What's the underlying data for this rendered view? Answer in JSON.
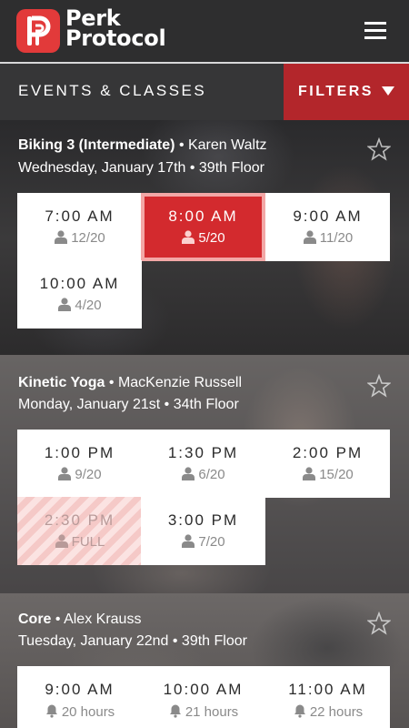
{
  "app": {
    "brand_line1": "Perk",
    "brand_line2": "Protocol"
  },
  "subbar": {
    "heading": "EVENTS & CLASSES",
    "filters_label": "FILTERS"
  },
  "colors": {
    "accent": "#d32a2e",
    "filters_bg": "#b3262b",
    "logo": "#e23a3a"
  },
  "events": [
    {
      "name": "Biking 3 (Intermediate)",
      "instructor": "• Karen Waltz",
      "date_line": "Wednesday, January 17th • 39th Floor",
      "slots": [
        {
          "time": "7:00 AM",
          "capacity": "12/20",
          "icon": "person-icon"
        },
        {
          "time": "8:00 AM",
          "capacity": "5/20",
          "icon": "person-icon",
          "state": "selected"
        },
        {
          "time": "9:00 AM",
          "capacity": "11/20",
          "icon": "person-icon"
        },
        {
          "time": "10:00 AM",
          "capacity": "4/20",
          "icon": "person-icon"
        }
      ]
    },
    {
      "name": "Kinetic Yoga",
      "instructor": "• MacKenzie Russell",
      "date_line": "Monday, January 21st • 34th Floor",
      "slots": [
        {
          "time": "1:00 PM",
          "capacity": "9/20",
          "icon": "person-icon"
        },
        {
          "time": "1:30 PM",
          "capacity": "6/20",
          "icon": "person-icon"
        },
        {
          "time": "2:00 PM",
          "capacity": "15/20",
          "icon": "person-icon"
        },
        {
          "time": "2:30 PM",
          "capacity": "FULL",
          "icon": "person-icon",
          "state": "full"
        },
        {
          "time": "3:00 PM",
          "capacity": "7/20",
          "icon": "person-icon"
        }
      ]
    },
    {
      "name": "Core",
      "instructor": "• Alex Krauss",
      "date_line": "Tuesday, January 22nd • 39th Floor",
      "slots": [
        {
          "time": "9:00 AM",
          "capacity": "20 hours",
          "icon": "bell-icon"
        },
        {
          "time": "10:00 AM",
          "capacity": "21 hours",
          "icon": "bell-icon"
        },
        {
          "time": "11:00 AM",
          "capacity": "22 hours",
          "icon": "bell-icon"
        }
      ]
    }
  ]
}
